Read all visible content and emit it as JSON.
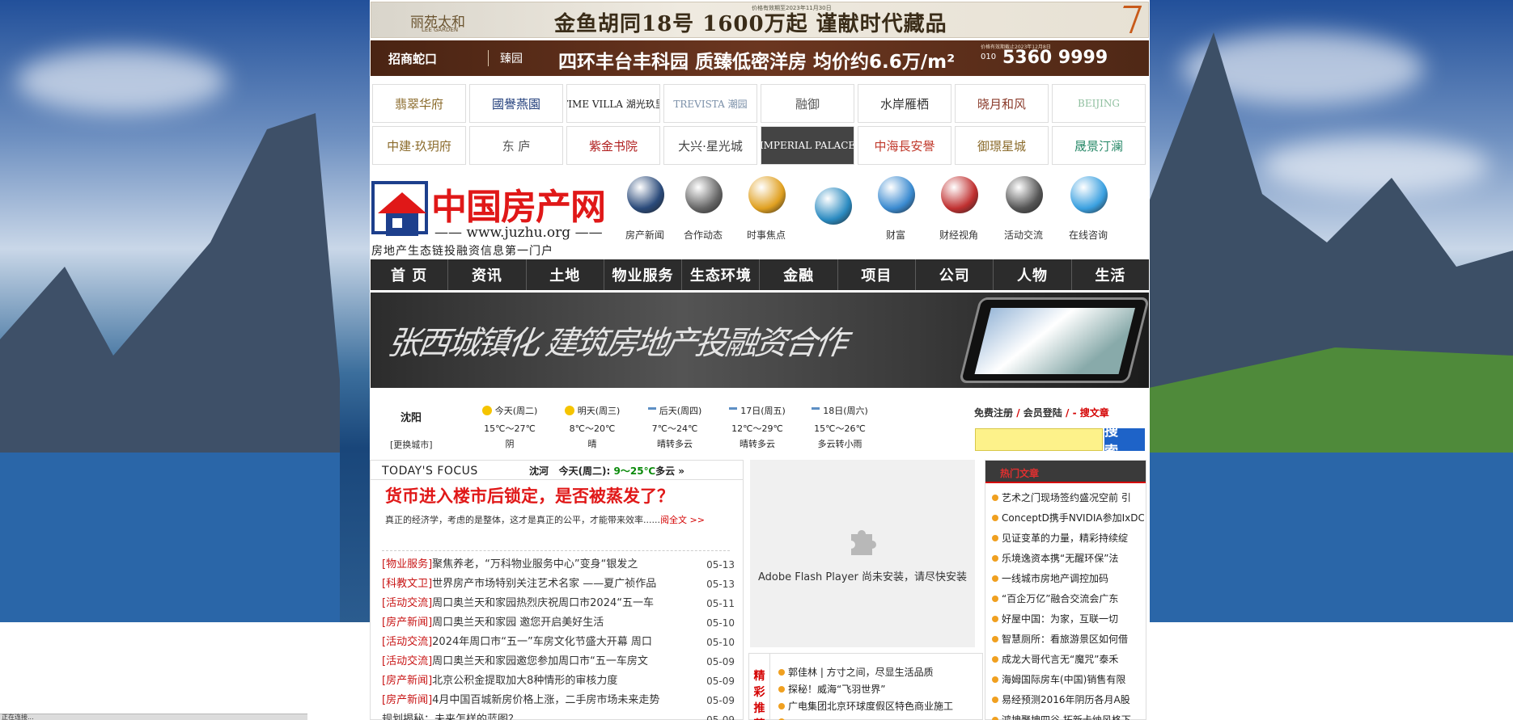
{
  "banners": {
    "top": {
      "brand": "丽苑太和",
      "brand_sub": "LEE GARDEN",
      "headline": "金鱼胡同18号 1600万起 谨献时代藏品",
      "note": "价格有效期至2023年11月30日"
    },
    "second": {
      "brand": "招商蛇口",
      "brand2": "臻园",
      "headline": "四环丰台丰科园 质臻低密洋房 均价约6.6万/m²",
      "note": "价格有效期截止2023年12月8日",
      "tel_prefix": "010",
      "tel": "5360 9999"
    }
  },
  "project_logos": [
    {
      "label": "翡翠华府",
      "color": "#8a6a2a"
    },
    {
      "label": "國譽燕園",
      "color": "#1f3c7a"
    },
    {
      "label": "TIME VILLA 湖光玖里",
      "color": "#222222"
    },
    {
      "label": "TREVISTA 潮园",
      "color": "#7a8fa8"
    },
    {
      "label": "融御",
      "color": "#555555"
    },
    {
      "label": "水岸雁栖",
      "color": "#333333"
    },
    {
      "label": "晓月和风",
      "color": "#8a3a2a"
    },
    {
      "label": "BEIJING",
      "color": "#8fbf9f"
    },
    {
      "label": "中建·玖玥府",
      "color": "#8a6a2a"
    },
    {
      "label": "东 庐",
      "color": "#555555"
    },
    {
      "label": "紫金书院",
      "color": "#b01e1e"
    },
    {
      "label": "大兴·星光城",
      "color": "#444444"
    },
    {
      "label": "IMPERIAL PALACE",
      "color": "#ffffff"
    },
    {
      "label": "中海長安譽",
      "color": "#c0392b"
    },
    {
      "label": "御璟星城",
      "color": "#8a6a2a"
    },
    {
      "label": "晟景汀澜",
      "color": "#2a8a6a"
    }
  ],
  "site": {
    "title": "中国房产网",
    "url": "—— www.juzhu.org ——",
    "slogan": "房地产生态链投融资信息第一门户"
  },
  "icon_links": [
    {
      "icon": "compass-icon",
      "label": "房产新闻",
      "color": "#2a4a7a"
    },
    {
      "icon": "gear-icon",
      "label": "合作动态",
      "color": "#666666"
    },
    {
      "icon": "pie-chart-icon",
      "label": "时事焦点",
      "color": "#e0a020"
    },
    {
      "icon": "magnifier-globe-icon",
      "label": "",
      "color": "#2a8ac0"
    },
    {
      "icon": "globe-icon",
      "label": "财富",
      "color": "#3a8ad0"
    },
    {
      "icon": "businessman-icon",
      "label": "财经视角",
      "color": "#c03030"
    },
    {
      "icon": "microphone-icon",
      "label": "活动交流",
      "color": "#555555"
    },
    {
      "icon": "chat-bubbles-icon",
      "label": "在线咨询",
      "color": "#3aa0e0"
    }
  ],
  "nav": [
    "首 页",
    "资讯",
    "土地",
    "物业服务",
    "生态环境",
    "金融",
    "项目",
    "公司",
    "人物",
    "生活"
  ],
  "promo": {
    "text": "张西城镇化 建筑房地产投融资合作"
  },
  "weather": {
    "city": "沈阳",
    "change_city": "[更换城市]",
    "days": [
      {
        "title": "今天(周二)",
        "temp": "15℃～27℃",
        "cond": "阴",
        "icon": "sun"
      },
      {
        "title": "明天(周三)",
        "temp": "8℃～20℃",
        "cond": "晴",
        "icon": "sun"
      },
      {
        "title": "后天(周四)",
        "temp": "7℃～24℃",
        "cond": "晴转多云",
        "icon": "rain"
      },
      {
        "title": "17日(周五)",
        "temp": "12℃～29℃",
        "cond": "晴转多云",
        "icon": "rain"
      },
      {
        "title": "18日(周六)",
        "temp": "15℃～26℃",
        "cond": "多云转小雨",
        "icon": "rain"
      }
    ]
  },
  "account": {
    "register": "免费注册",
    "login": "会员登陆",
    "sep": "/",
    "search_articles": "- 搜文章",
    "search_button": "搜 索"
  },
  "focus": {
    "label": "TODAY'S FOCUS",
    "weather_city": "沈河",
    "weather_day": "今天(周二):",
    "weather_range": "9～25℃",
    "weather_cond": "多云 »",
    "headline": "货币进入楼市后锁定，是否被蒸发了？",
    "summary": "真正的经济学，考虑的是整体，这才是真正的公平，才能带来效率......",
    "more": "阅全文 >>"
  },
  "news": [
    {
      "cat": "[物业服务]",
      "title": "聚焦养老，“万科物业服务中心”变身“银发之",
      "date": "05-13"
    },
    {
      "cat": "[科教文卫]",
      "title": "世界房产市场特别关注艺术名家 ——夏广祯作品",
      "date": "05-13"
    },
    {
      "cat": "[活动交流]",
      "title": "周口奥兰天和家园热烈庆祝周口市2024“五一车",
      "date": "05-11"
    },
    {
      "cat": "[房产新闻]",
      "title": "周口奥兰天和家园 邀您开启美好生活",
      "date": "05-10"
    },
    {
      "cat": "[活动交流]",
      "title": "2024年周口市“五一”车房文化节盛大开幕 周口",
      "date": "05-10"
    },
    {
      "cat": "[活动交流]",
      "title": "周口奥兰天和家园邀您参加周口市“五一车房文",
      "date": "05-09"
    },
    {
      "cat": "[房产新闻]",
      "title": "北京公积金提取加大8种情形的审核力度",
      "date": "05-09"
    },
    {
      "cat": "[房产新闻]",
      "title": "4月中国百城新房价格上涨，二手房市场未来走势",
      "date": "05-09"
    },
    {
      "cat": "",
      "title": "规划揭秘：未来怎样的蓝图？",
      "date": "05-09"
    }
  ],
  "flash": {
    "text": "Adobe Flash Player 尚未安装，请尽快安装"
  },
  "picks": {
    "tab": "精彩推荐",
    "items": [
      "郭佳林 | 方寸之间，尽显生活品质",
      "探秘！威海“飞羽世界”",
      "广电集团北京环球度假区特色商业施工",
      "…"
    ]
  },
  "hot": {
    "title": "热门文章",
    "items": [
      "艺术之门现场签约盛况空前 引",
      "ConceptD携手NVIDIA参加IxDC",
      "见证变革的力量，精彩持续绽",
      "乐境逸资本携“无醒环保”法",
      "一线城市房地产调控加码",
      "“百企万亿”融合交流会广东",
      "好屋中国：为家，互联一切",
      "智慧厕所：看旅游景区如何借",
      "成龙大哥代言无“魔咒”泰禾",
      "海姆国际房车(中国)销售有限",
      "易经预测2016年阴历各月A股",
      "鸿坤聚坤四谷 拓新卡纳风格下"
    ]
  },
  "status": {
    "text": "正在连接..."
  }
}
